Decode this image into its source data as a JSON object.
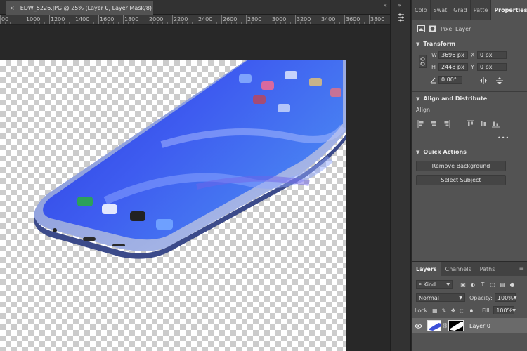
{
  "document": {
    "close_glyph": "×",
    "tab_title": "EDW_5226.JPG @ 25% (Layer 0, Layer Mask/8)",
    "collapse_glyph": "«"
  },
  "ruler": {
    "labels": [
      "00",
      "1000",
      "1200",
      "1400",
      "1600",
      "1800",
      "2000",
      "2200",
      "2400",
      "2600",
      "2800",
      "3000",
      "3200",
      "3400",
      "3600",
      "3800"
    ]
  },
  "side_strip": {
    "collapse_glyph": "»"
  },
  "properties": {
    "tabs": [
      "Colo",
      "Swat",
      "Grad",
      "Patte",
      "Properties"
    ],
    "active_tab": "Properties",
    "menu_glyph": "≡",
    "layer_type": "Pixel Layer",
    "transform": {
      "title": "Transform",
      "w_label": "W",
      "w_value": "3696 px",
      "x_label": "X",
      "x_value": "0 px",
      "h_label": "H",
      "h_value": "2448 px",
      "y_label": "Y",
      "y_value": "0 px",
      "angle_value": "0.00°"
    },
    "align": {
      "title": "Align and Distribute",
      "label": "Align:",
      "more": "•••"
    },
    "quick_actions": {
      "title": "Quick Actions",
      "remove_background": "Remove Background",
      "select_subject": "Select Subject"
    }
  },
  "layers": {
    "tabs": [
      "Layers",
      "Channels",
      "Paths"
    ],
    "active_tab": "Layers",
    "menu_glyph": "≡",
    "filter_kind": "Kind",
    "blend_mode": "Normal",
    "opacity_label": "Opacity:",
    "opacity_value": "100%",
    "lock_label": "Lock:",
    "fill_label": "Fill:",
    "fill_value": "100%",
    "items": [
      {
        "name": "Layer 0",
        "visible": true,
        "has_mask": true,
        "selected": true
      }
    ]
  },
  "colors": {
    "panel_bg": "#535353",
    "canvas_bg": "#282828",
    "phone_blue": "#3b4fd8",
    "phone_frame": "#9aa6d8"
  }
}
